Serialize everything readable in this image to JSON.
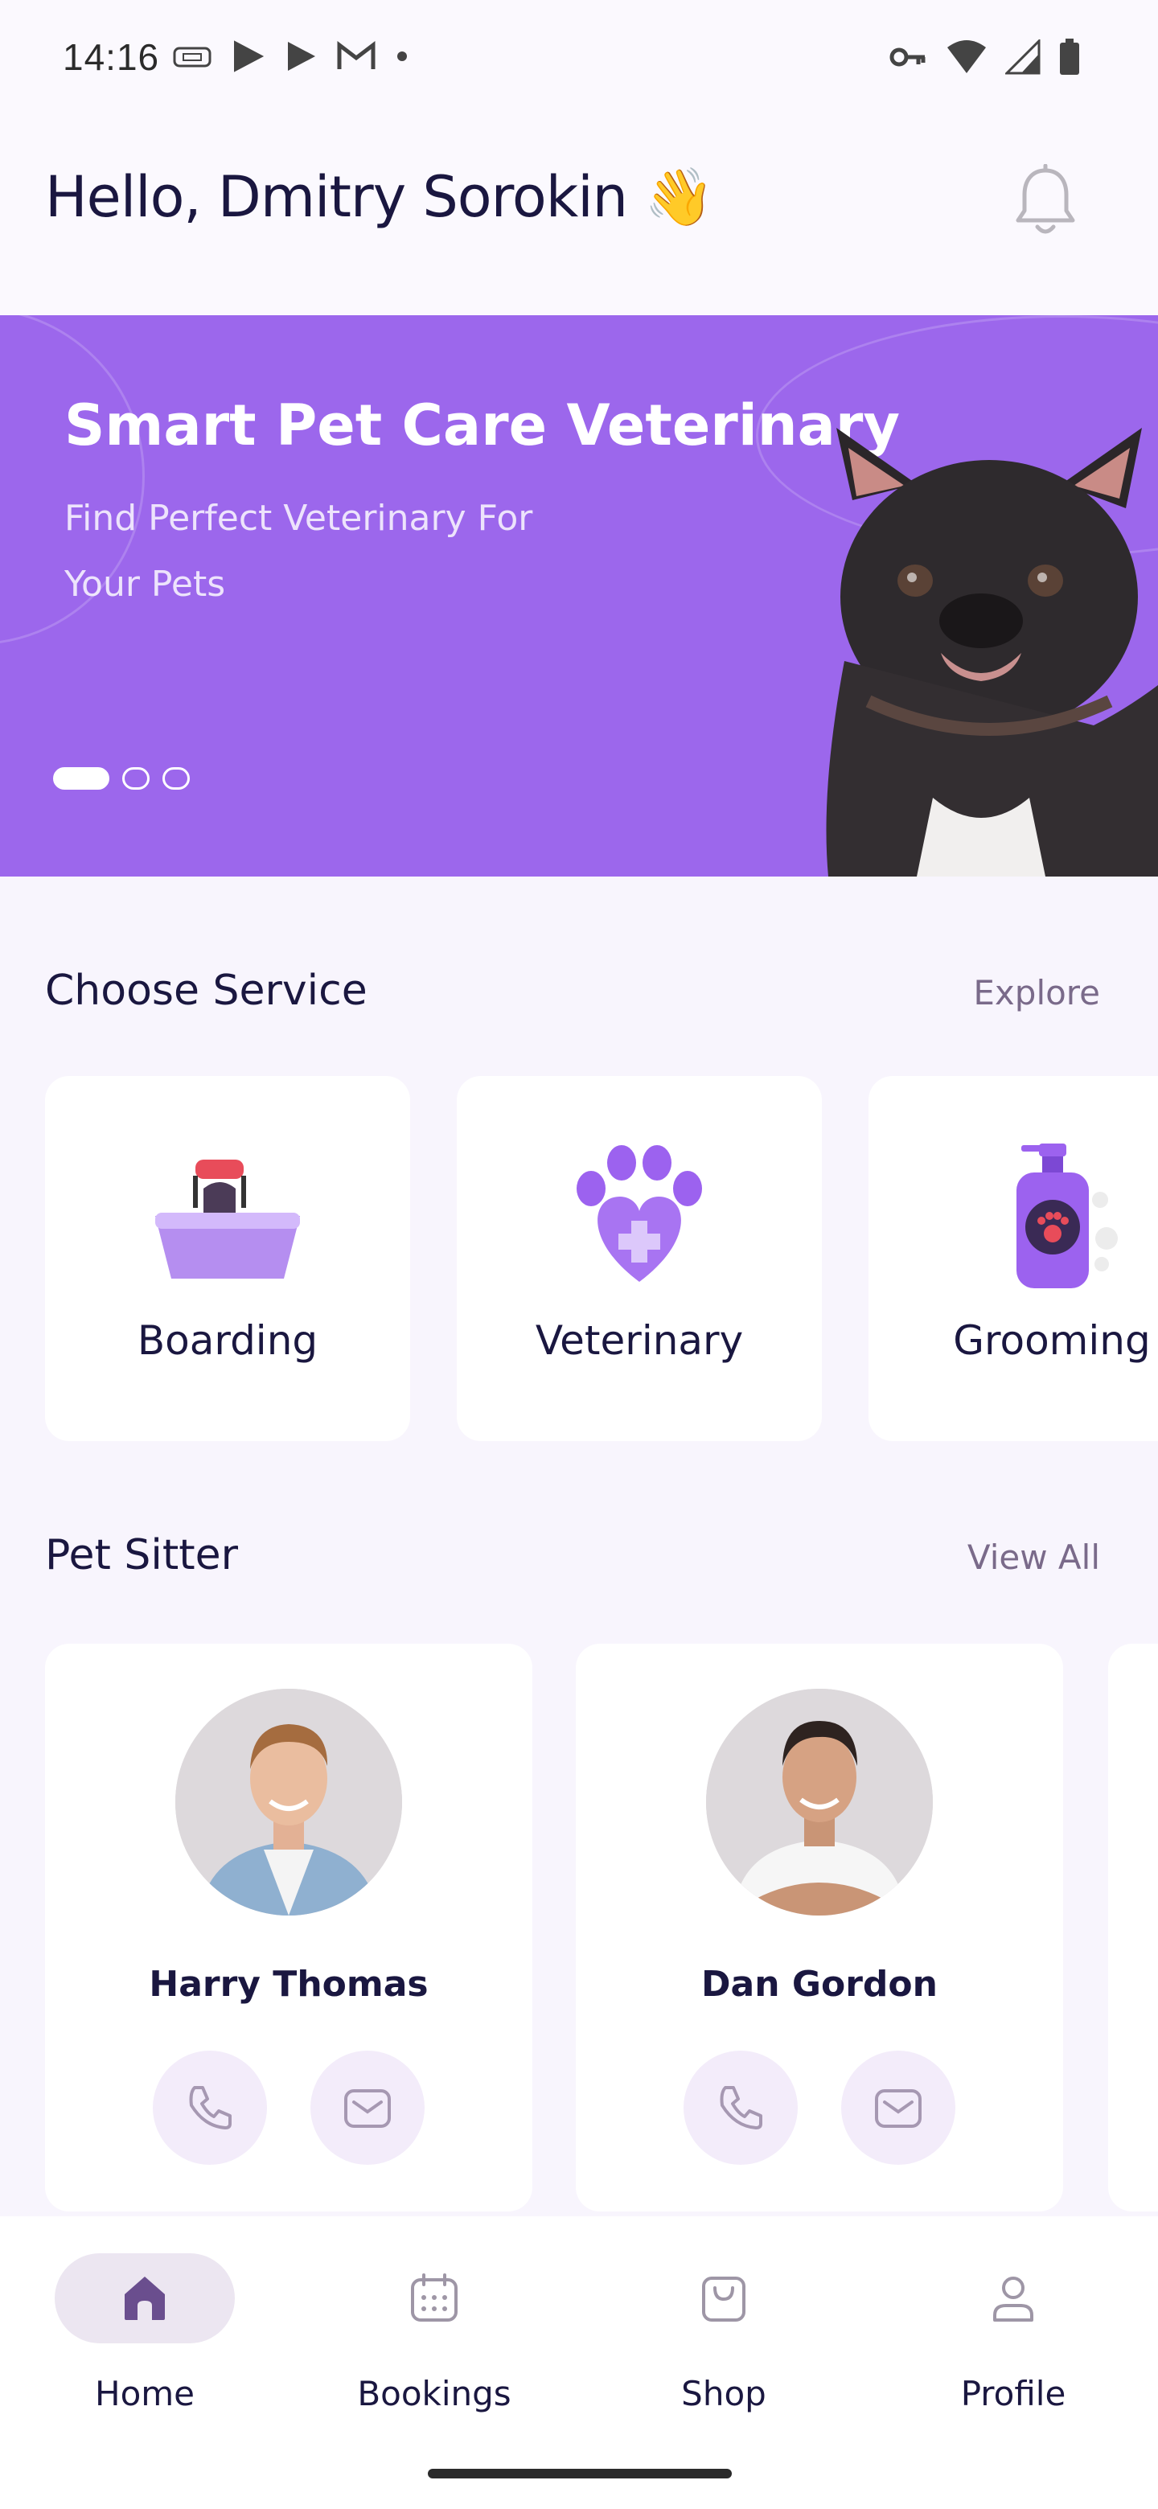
{
  "status_bar": {
    "time": "14:16"
  },
  "header": {
    "greeting": "Hello, Dmitry Sorokin 👋"
  },
  "banner": {
    "title": "Smart Pet Care Veterinary",
    "subtitle": "Find Perfect Veterinary For Your Pets",
    "active_slide": 1,
    "slide_count": 3
  },
  "services": {
    "title": "Choose Service",
    "link": "Explore",
    "items": [
      {
        "label": "Boarding",
        "icon": "pet-carrier-icon"
      },
      {
        "label": "Veterinary",
        "icon": "paw-heart-icon"
      },
      {
        "label": "Grooming",
        "icon": "shampoo-bottle-icon"
      }
    ]
  },
  "sitters": {
    "title": "Pet Sitter",
    "link": "View All",
    "items": [
      {
        "name": "Harry  Thomas"
      },
      {
        "name": "Dan Gordon"
      }
    ]
  },
  "nav": {
    "items": [
      {
        "label": "Home",
        "icon": "home-icon",
        "active": true
      },
      {
        "label": "Bookings",
        "icon": "calendar-icon",
        "active": false
      },
      {
        "label": "Shop",
        "icon": "shopping-bag-icon",
        "active": false
      },
      {
        "label": "Profile",
        "icon": "user-icon",
        "active": false
      }
    ]
  },
  "colors": {
    "accent": "#9c67ec",
    "text_dark": "#1a1740",
    "nav_active_bg": "#ece6f1",
    "action_bg": "#f3ecfa"
  }
}
